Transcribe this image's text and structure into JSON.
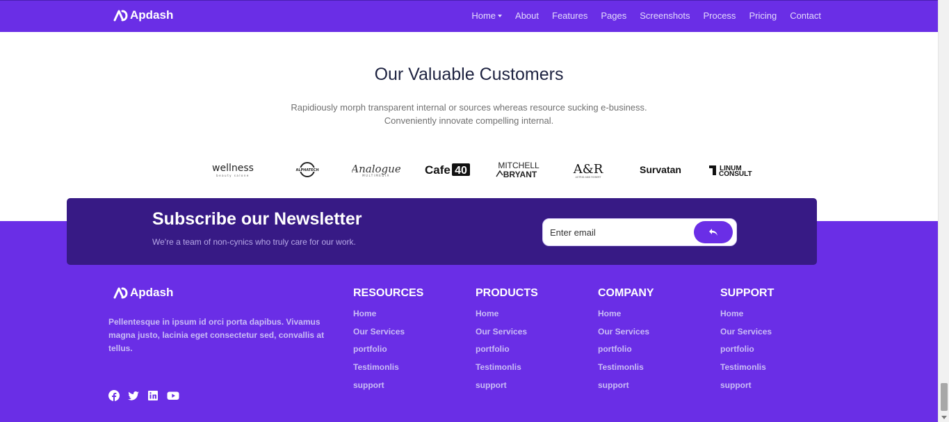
{
  "navbar": {
    "brand": "Apdash",
    "links": [
      "Home",
      "About",
      "Features",
      "Pages",
      "Screenshots",
      "Process",
      "Pricing",
      "Contact"
    ]
  },
  "customers": {
    "title": "Our Valuable Customers",
    "subtitle_line1": "Rapidiously morph transparent internal or sources whereas resource sucking e-business.",
    "subtitle_line2": "Conveniently innovate compelling internal.",
    "logos": [
      "wellness",
      "ALPHATECH",
      "Analogue",
      "Cafe40",
      "MITCHELL BRYANT",
      "A&R",
      "Survatan",
      "LINUM CONSULT"
    ]
  },
  "newsletter": {
    "title": "Subscribe our Newsletter",
    "subtitle": "We're a team of non-cynics who truly care for our work.",
    "placeholder": "Enter email"
  },
  "footer": {
    "brand": "Apdash",
    "description": "Pellentesque in ipsum id orci porta dapibus. Vivamus magna justo, lacinia eget consectetur sed, convallis at tellus.",
    "social": [
      "facebook-icon",
      "twitter-icon",
      "linkedin-icon",
      "youtube-icon"
    ],
    "columns": [
      {
        "title": "RESOURCES",
        "links": [
          "Home",
          "Our Services",
          "portfolio",
          "Testimonlis",
          "support"
        ]
      },
      {
        "title": "PRODUCTS",
        "links": [
          "Home",
          "Our Services",
          "portfolio",
          "Testimonlis",
          "support"
        ]
      },
      {
        "title": "COMPANY",
        "links": [
          "Home",
          "Our Services",
          "portfolio",
          "Testimonlis",
          "support"
        ]
      },
      {
        "title": "SUPPORT",
        "links": [
          "Home",
          "Our Services",
          "portfolio",
          "Testimonlis",
          "support"
        ]
      }
    ]
  },
  "colors": {
    "primary": "#6a2ee6",
    "newsletter_bg": "#371a85",
    "heading": "#1d2240"
  }
}
